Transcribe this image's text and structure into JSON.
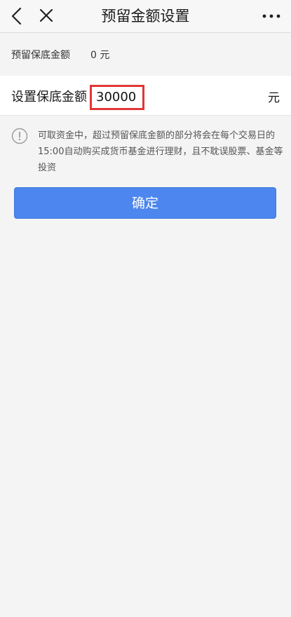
{
  "header": {
    "title": "预留金额设置",
    "back_icon": "chevron-left-icon",
    "close_icon": "close-icon",
    "more_icon": "more-dots-icon"
  },
  "reserved": {
    "label": "预留保底金额",
    "value": "0 元"
  },
  "set_amount": {
    "label": "设置保底金额",
    "value": "30000",
    "unit": "元",
    "highlight_color": "#e23636"
  },
  "notice": {
    "icon": "info-exclamation-icon",
    "text": "可取资金中，超过预留保底金额的部分将会在每个交易日的15:00自动购买成货币基金进行理财，且不耽误股票、基金等投资"
  },
  "confirm": {
    "label": "确定",
    "color": "#4c86ee"
  }
}
